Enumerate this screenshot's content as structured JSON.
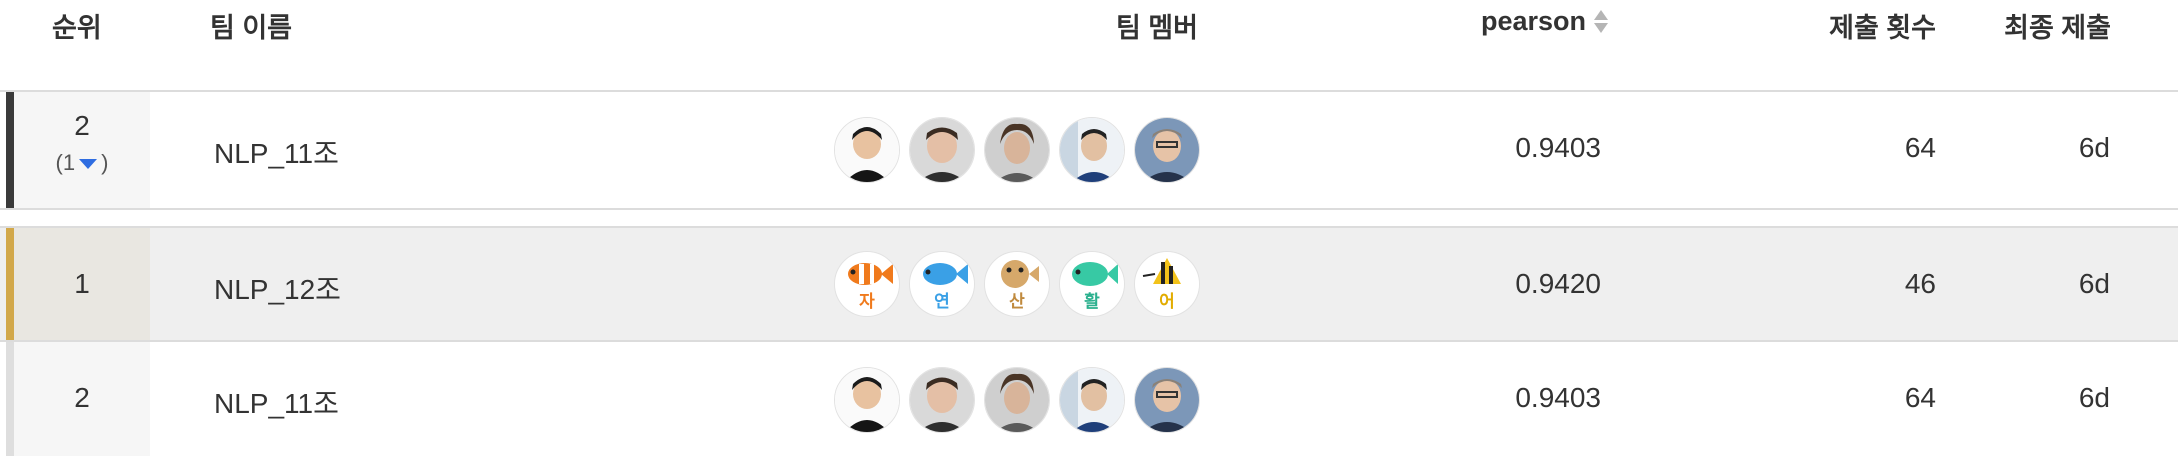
{
  "header": {
    "rank": "순위",
    "team_name": "팀 이름",
    "members": "팀 멤버",
    "score": "pearson",
    "submissions": "제출 횟수",
    "last_submit": "최종 제출"
  },
  "rows": [
    {
      "rank": "2",
      "change_open": "(1",
      "change_close": ")",
      "team": "NLP_11조",
      "score": "0.9403",
      "submissions": "64",
      "last": "6d",
      "highlight": false
    },
    {
      "rank": "1",
      "team": "NLP_12조",
      "score": "0.9420",
      "submissions": "46",
      "last": "6d",
      "highlight": true,
      "member_labels": [
        "자",
        "연",
        "산",
        "활",
        "어"
      ]
    },
    {
      "rank": "2",
      "team": "NLP_11조",
      "score": "0.9403",
      "submissions": "64",
      "last": "6d",
      "highlight": false
    }
  ],
  "colors": {
    "accent_gold": "#d2a84a",
    "accent_dark": "#3a3a3a",
    "rank_down": "#2f6de1"
  },
  "icons": {
    "sort": "sort-arrows-icon",
    "rank_change": "triangle-down-icon"
  }
}
